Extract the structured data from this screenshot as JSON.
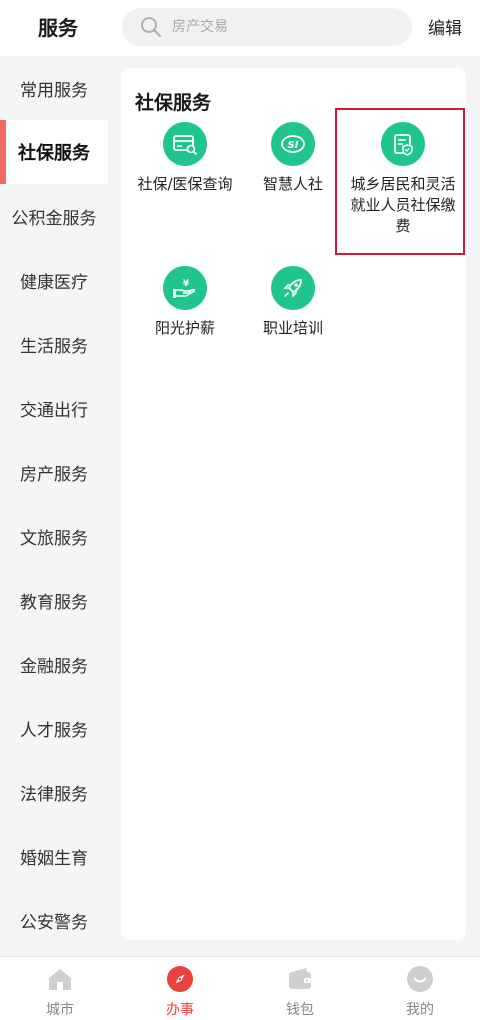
{
  "header": {
    "title": "服务",
    "search_placeholder": "房产交易",
    "edit_label": "编辑"
  },
  "sidebar": {
    "items": [
      {
        "label": "常用服务",
        "active": false
      },
      {
        "label": "社保服务",
        "active": true
      },
      {
        "label": "公积金服务",
        "active": false
      },
      {
        "label": "健康医疗",
        "active": false
      },
      {
        "label": "生活服务",
        "active": false
      },
      {
        "label": "交通出行",
        "active": false
      },
      {
        "label": "房产服务",
        "active": false
      },
      {
        "label": "文旅服务",
        "active": false
      },
      {
        "label": "教育服务",
        "active": false
      },
      {
        "label": "金融服务",
        "active": false
      },
      {
        "label": "人才服务",
        "active": false
      },
      {
        "label": "法律服务",
        "active": false
      },
      {
        "label": "婚姻生育",
        "active": false
      },
      {
        "label": "公安警务",
        "active": false
      }
    ]
  },
  "content": {
    "section_title": "社保服务",
    "services": [
      {
        "label": "社保/医保查询",
        "icon": "card-search-icon"
      },
      {
        "label": "智慧人社",
        "icon": "si-logo-icon"
      },
      {
        "label": "城乡居民和灵活就业人员社保缴费",
        "icon": "document-shield-icon"
      },
      {
        "label": "阳光护薪",
        "icon": "hand-yuan-icon"
      },
      {
        "label": "职业培训",
        "icon": "rocket-icon"
      }
    ]
  },
  "tabbar": {
    "tabs": [
      {
        "label": "城市",
        "icon": "home-icon",
        "active": false
      },
      {
        "label": "办事",
        "icon": "compass-icon",
        "active": true
      },
      {
        "label": "钱包",
        "icon": "wallet-icon",
        "active": false
      },
      {
        "label": "我的",
        "icon": "profile-icon",
        "active": false
      }
    ]
  },
  "colors": {
    "accent_red": "#e8443d",
    "service_green": "#20c58c",
    "sidebar_indicator": "#f06a63",
    "highlight_border": "#d0183a"
  }
}
